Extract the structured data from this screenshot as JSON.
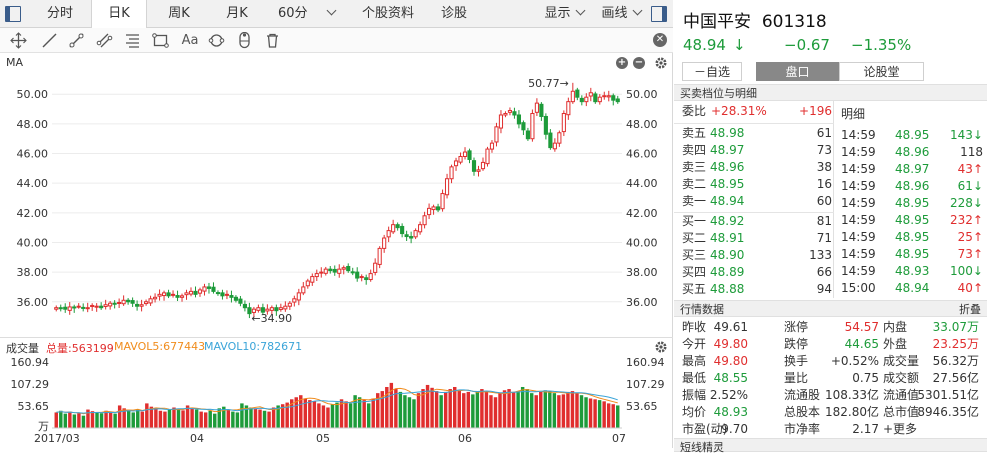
{
  "tabs": [
    {
      "label": "分时",
      "active": false
    },
    {
      "label": "日K",
      "active": true
    },
    {
      "label": "周K",
      "active": false
    },
    {
      "label": "月K",
      "active": false
    },
    {
      "label": "60分",
      "active": false,
      "dropdown": true
    },
    {
      "label": "个股资料",
      "active": false
    },
    {
      "label": "诊股",
      "active": false
    }
  ],
  "right_tabs": [
    {
      "label": "显示"
    },
    {
      "label": "画线"
    }
  ],
  "toolbar_icons": [
    "crosshair-icon",
    "line-tool-icon",
    "ray-tool-icon",
    "multi-line-icon",
    "fib-tool-icon",
    "rect-tool-icon",
    "text-tool-icon",
    "cycle-tool-icon",
    "magnet-tool-icon",
    "trash-icon"
  ],
  "toolbar_text_icon": "Aa",
  "main_chart": {
    "indicator_label": "MA",
    "y_ticks": [
      "50.00",
      "48.00",
      "46.00",
      "44.00",
      "42.00",
      "40.00",
      "38.00",
      "36.00"
    ],
    "high_label": "50.77→",
    "low_label": "←34.90"
  },
  "volume_chart": {
    "title": "成交量",
    "total_label": "总量:563199",
    "mavol5_label": "MAVOL5:677443",
    "mavol10_label": "MAVOL10:782671",
    "y_ticks": [
      "160.94",
      "107.29",
      "53.65"
    ],
    "unit": "万",
    "x_ticks": [
      "2017/03",
      "04",
      "05",
      "06",
      "07"
    ]
  },
  "colors": {
    "up": "#e02e2e",
    "down": "#1d9b3a",
    "ma5": "#f08c1c",
    "ma10": "#3aa4d8",
    "accent": "#3a5c8a"
  },
  "chart_data": {
    "type": "bar",
    "title": "",
    "daily_closes": [
      35.6,
      35.55,
      35.5,
      35.65,
      35.6,
      35.7,
      35.55,
      35.6,
      35.75,
      35.7,
      35.6,
      35.8,
      35.9,
      35.85,
      35.95,
      36.1,
      36.0,
      35.9,
      35.7,
      35.8,
      36.0,
      36.2,
      36.3,
      36.5,
      36.6,
      36.4,
      36.5,
      36.3,
      36.4,
      36.6,
      36.7,
      36.5,
      36.8,
      37.0,
      36.9,
      36.7,
      36.6,
      36.4,
      36.5,
      36.3,
      36.1,
      35.9,
      35.6,
      35.2,
      35.5,
      35.6,
      35.3,
      35.5,
      35.6,
      35.4,
      35.6,
      35.7,
      35.9,
      36.2,
      36.6,
      37.0,
      37.4,
      37.7,
      37.9,
      38.0,
      38.2,
      38.1,
      38.0,
      38.2,
      38.3,
      38.1,
      38.0,
      37.6,
      37.7,
      37.5,
      37.9,
      38.6,
      39.6,
      40.3,
      40.8,
      41.2,
      41.0,
      40.6,
      40.4,
      40.3,
      40.8,
      41.2,
      41.8,
      42.3,
      42.4,
      42.2,
      43.3,
      44.3,
      45.1,
      45.5,
      45.8,
      46.1,
      45.6,
      44.8,
      44.9,
      45.4,
      46.3,
      46.7,
      47.8,
      48.6,
      48.7,
      48.9,
      48.6,
      48.0,
      47.6,
      47.0,
      48.7,
      49.4,
      48.5,
      47.3,
      46.4,
      46.7,
      47.4,
      48.7,
      49.5,
      50.2,
      49.8,
      49.5,
      49.8,
      50.1,
      49.5,
      49.8,
      49.9,
      49.9,
      49.6,
      49.5
    ],
    "high": 50.77,
    "low": 34.9,
    "volume_values_wan": [
      38,
      42,
      35,
      40,
      33,
      36,
      30,
      45,
      41,
      38,
      36,
      42,
      40,
      35,
      55,
      48,
      42,
      38,
      45,
      40,
      60,
      52,
      48,
      42,
      40,
      45,
      50,
      47,
      43,
      55,
      50,
      45,
      40,
      38,
      42,
      35,
      48,
      52,
      45,
      40,
      38,
      60,
      55,
      50,
      48,
      45,
      42,
      40,
      50,
      55,
      58,
      62,
      70,
      75,
      80,
      72,
      68,
      65,
      60,
      55,
      50,
      58,
      62,
      70,
      65,
      60,
      80,
      75,
      68,
      60,
      72,
      85,
      90,
      100,
      110,
      95,
      88,
      80,
      75,
      70,
      85,
      95,
      105,
      98,
      90,
      80,
      88,
      95,
      100,
      92,
      85,
      88,
      82,
      90,
      95,
      88,
      80,
      75,
      85,
      92,
      95,
      88,
      90,
      100,
      95,
      85,
      80,
      88,
      92,
      90,
      85,
      80,
      82,
      88,
      90,
      85,
      80,
      75,
      72,
      70,
      68,
      65,
      60,
      58,
      55
    ],
    "ylim": [
      34.5,
      51.5
    ],
    "vol_ylim": [
      0,
      160.94
    ],
    "x_ticks": [
      "2017/03",
      "04",
      "05",
      "06",
      "07"
    ]
  },
  "stock": {
    "name": "中国平安",
    "code": "601318",
    "price": "48.94",
    "arrow": "↓",
    "change": "−0.67",
    "change_pct": "−1.35%"
  },
  "rtabs": [
    {
      "label": "－自选",
      "active": false
    },
    {
      "label": "盘口",
      "active": true
    },
    {
      "label": "论股堂",
      "active": false
    }
  ],
  "orderbook": {
    "header": "买卖档位与明细",
    "weibi_label": "委比",
    "weibi_pct": "+28.31%",
    "weibi_val": "+196",
    "asks": [
      {
        "label": "卖五",
        "price": "48.98",
        "vol": "61"
      },
      {
        "label": "卖四",
        "price": "48.97",
        "vol": "73"
      },
      {
        "label": "卖三",
        "price": "48.96",
        "vol": "38"
      },
      {
        "label": "卖二",
        "price": "48.95",
        "vol": "16"
      },
      {
        "label": "卖一",
        "price": "48.94",
        "vol": "60"
      }
    ],
    "bids": [
      {
        "label": "买一",
        "price": "48.92",
        "vol": "81"
      },
      {
        "label": "买二",
        "price": "48.91",
        "vol": "71"
      },
      {
        "label": "买三",
        "price": "48.90",
        "vol": "133"
      },
      {
        "label": "买四",
        "price": "48.89",
        "vol": "66"
      },
      {
        "label": "买五",
        "price": "48.88",
        "vol": "94"
      }
    ]
  },
  "detail": {
    "title": "明细",
    "rows": [
      {
        "time": "14:59",
        "price": "48.95",
        "vol": "143↓",
        "dir": "down"
      },
      {
        "time": "14:59",
        "price": "48.96",
        "vol": "118",
        "dir": "flat"
      },
      {
        "time": "14:59",
        "price": "48.97",
        "vol": "43↑",
        "dir": "up"
      },
      {
        "time": "14:59",
        "price": "48.96",
        "vol": "61↓",
        "dir": "down"
      },
      {
        "time": "14:59",
        "price": "48.95",
        "vol": "228↓",
        "dir": "down"
      },
      {
        "time": "14:59",
        "price": "48.95",
        "vol": "232↑",
        "dir": "up"
      },
      {
        "time": "14:59",
        "price": "48.95",
        "vol": "25↑",
        "dir": "up"
      },
      {
        "time": "14:59",
        "price": "48.95",
        "vol": "73↑",
        "dir": "up"
      },
      {
        "time": "14:59",
        "price": "48.93",
        "vol": "100↓",
        "dir": "down"
      },
      {
        "time": "15:00",
        "price": "48.94",
        "vol": "40↑",
        "dir": "up"
      }
    ]
  },
  "quotes": {
    "header": "行情数据",
    "fold": "折叠",
    "rows": [
      [
        {
          "k": "昨收",
          "v": "49.61",
          "c": ""
        },
        {
          "k": "涨停",
          "v": "54.57",
          "c": "red"
        },
        {
          "k": "内盘",
          "v": "33.07万",
          "c": "green"
        }
      ],
      [
        {
          "k": "今开",
          "v": "49.80",
          "c": "red"
        },
        {
          "k": "跌停",
          "v": "44.65",
          "c": "green"
        },
        {
          "k": "外盘",
          "v": "23.25万",
          "c": "red"
        }
      ],
      [
        {
          "k": "最高",
          "v": "49.80",
          "c": "red"
        },
        {
          "k": "换手",
          "v": "+0.52%",
          "c": ""
        },
        {
          "k": "成交量",
          "v": "56.32万",
          "c": ""
        }
      ],
      [
        {
          "k": "最低",
          "v": "48.55",
          "c": "green"
        },
        {
          "k": "量比",
          "v": "0.75",
          "c": ""
        },
        {
          "k": "成交额",
          "v": "27.56亿",
          "c": ""
        }
      ],
      [
        {
          "k": "振幅",
          "v": "2.52%",
          "c": ""
        },
        {
          "k": "流通股",
          "v": "108.33亿",
          "c": ""
        },
        {
          "k": "流通值",
          "v": "5301.51亿",
          "c": ""
        }
      ],
      [
        {
          "k": "均价",
          "v": "48.93",
          "c": "green"
        },
        {
          "k": "总股本",
          "v": "182.80亿",
          "c": ""
        },
        {
          "k": "总市值",
          "v": "8946.35亿",
          "c": ""
        }
      ],
      [
        {
          "k": "市盈(动)",
          "v": "9.70",
          "c": ""
        },
        {
          "k": "市净率",
          "v": "2.17",
          "c": ""
        },
        {
          "k": "+更多",
          "v": "",
          "c": ""
        }
      ]
    ]
  },
  "bottom_header": "短线精灵"
}
